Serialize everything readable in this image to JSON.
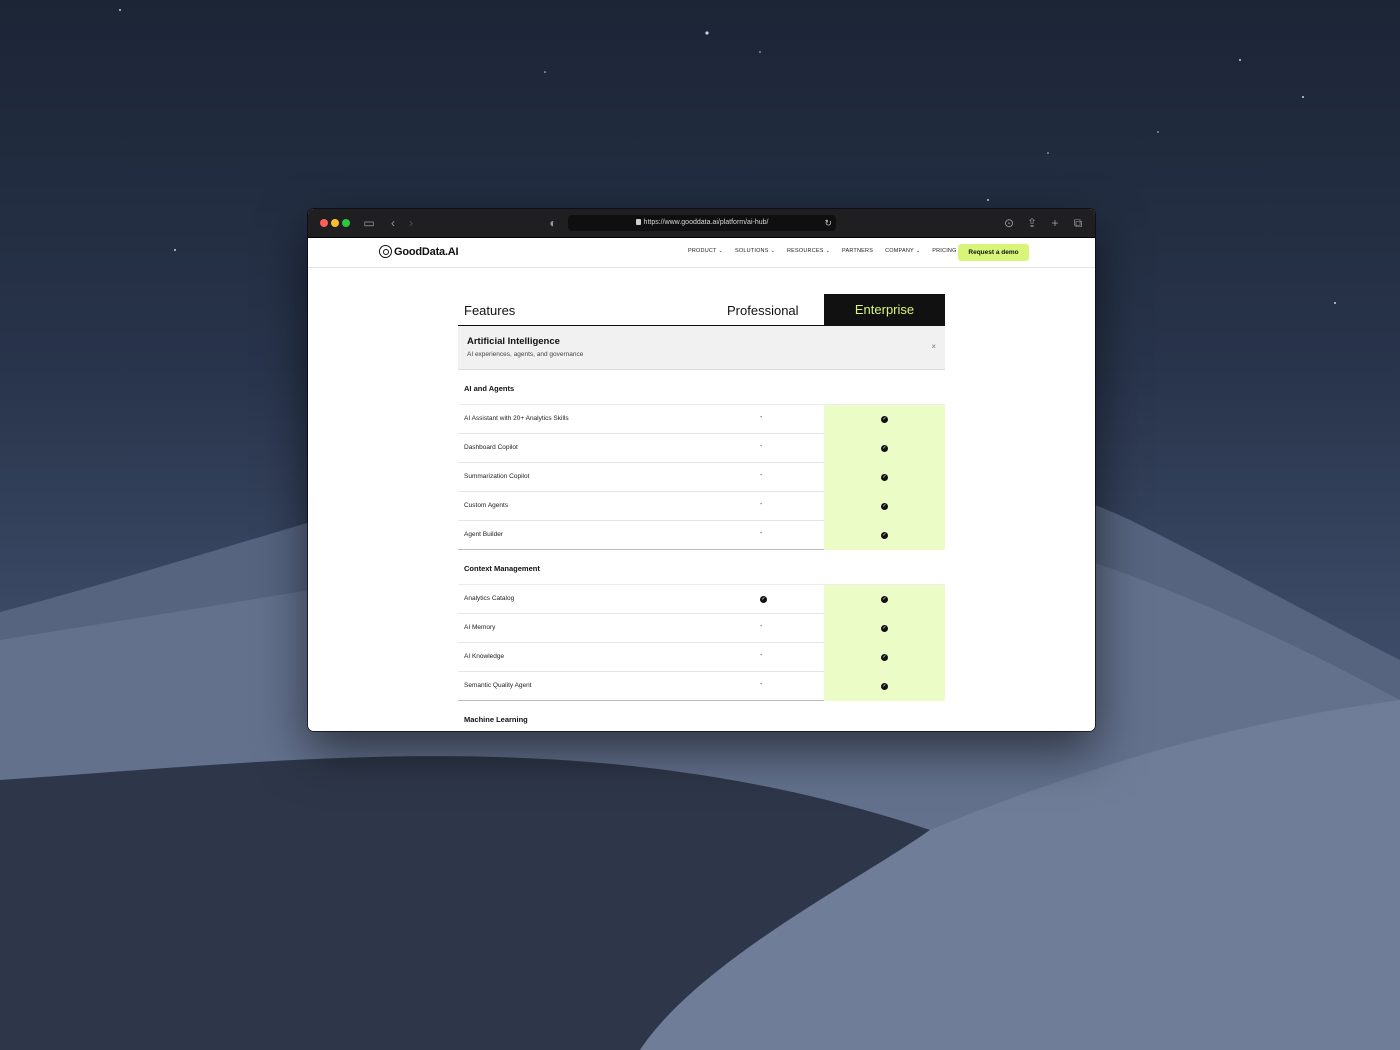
{
  "desktop": {
    "wallpaper": "sand dunes at night"
  },
  "browser": {
    "url": "https://www.gooddata.ai/platform/ai-hub/",
    "icons": [
      "sidebar-icon",
      "back-icon",
      "forward-icon",
      "shield-icon",
      "lock-icon",
      "reload-icon",
      "download-icon",
      "share-icon",
      "new-tab-icon",
      "tabs-icon"
    ]
  },
  "site": {
    "logo": "GoodData.AI",
    "nav": [
      {
        "label": "PRODUCT",
        "dropdown": true
      },
      {
        "label": "SOLUTIONS",
        "dropdown": true
      },
      {
        "label": "RESOURCES",
        "dropdown": true
      },
      {
        "label": "PARTNERS",
        "dropdown": false
      },
      {
        "label": "COMPANY",
        "dropdown": true
      },
      {
        "label": "PRICING",
        "dropdown": false
      }
    ],
    "cta": "Request a demo",
    "accent_color": "#d8f57a"
  },
  "table": {
    "headers": {
      "features": "Features",
      "professional": "Professional",
      "enterprise": "Enterprise"
    },
    "category": {
      "title": "Artificial Intelligence",
      "subtitle": "AI experiences, agents, and governance",
      "close": "×"
    },
    "groups": [
      {
        "title": "AI and Agents",
        "rows": [
          {
            "label": "AI Assistant with 20+ Analytics Skills",
            "professional": "-",
            "enterprise": "check"
          },
          {
            "label": "Dashboard Copilot",
            "professional": "-",
            "enterprise": "check"
          },
          {
            "label": "Summarization Copilot",
            "professional": "-",
            "enterprise": "check"
          },
          {
            "label": "Custom Agents",
            "professional": "-",
            "enterprise": "check"
          },
          {
            "label": "Agent Builder",
            "professional": "-",
            "enterprise": "check"
          }
        ]
      },
      {
        "title": "Context Management",
        "rows": [
          {
            "label": "Analytics Catalog",
            "professional": "check",
            "enterprise": "check"
          },
          {
            "label": "AI Memory",
            "professional": "-",
            "enterprise": "check"
          },
          {
            "label": "AI Knowledge",
            "professional": "-",
            "enterprise": "check"
          },
          {
            "label": "Semantic Quality Agent",
            "professional": "-",
            "enterprise": "check"
          }
        ]
      },
      {
        "title": "Machine Learning",
        "rows": []
      }
    ]
  }
}
